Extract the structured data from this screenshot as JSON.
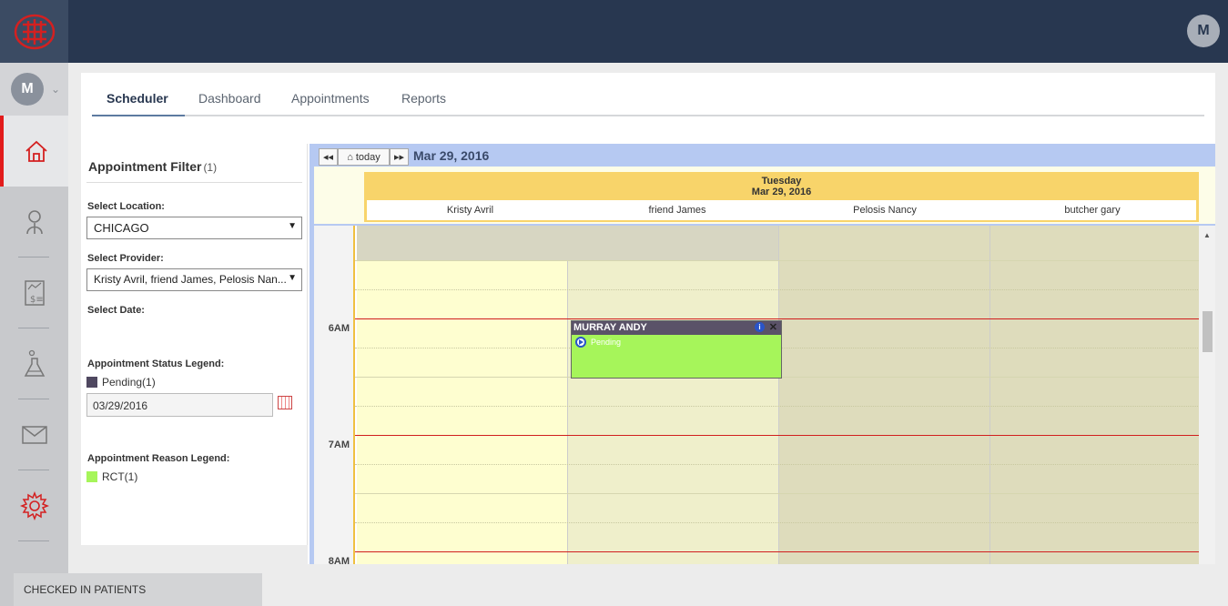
{
  "user": {
    "initial": "M"
  },
  "nav": {
    "items": [
      {
        "name": "home",
        "icon": "home-icon"
      },
      {
        "name": "patients",
        "icon": "person-icon"
      },
      {
        "name": "billing",
        "icon": "invoice-icon"
      },
      {
        "name": "lab",
        "icon": "flask-icon"
      },
      {
        "name": "messages",
        "icon": "mail-icon"
      },
      {
        "name": "settings",
        "icon": "gear-icon"
      }
    ],
    "accent": "#e21b1b"
  },
  "tabs": {
    "scheduler": "Scheduler",
    "dashboard": "Dashboard",
    "appointments": "Appointments",
    "reports": "Reports"
  },
  "filter": {
    "title": "Appointment Filter",
    "count": "(1)",
    "location_label": "Select Location:",
    "location_value": "CHICAGO",
    "provider_label": "Select Provider:",
    "provider_value": "Kristy Avril, friend James, Pelosis Nan...",
    "date_label": "Select Date:",
    "date_value": "03/29/2016",
    "status_legend_label": "Appointment Status Legend:",
    "status_legend": [
      {
        "label": "Pending(1)",
        "color": "#4f4860"
      }
    ],
    "reason_legend_label": "Appointment Reason Legend:",
    "reason_legend": [
      {
        "label": "RCT(1)",
        "color": "#a6f55a"
      }
    ]
  },
  "calendar": {
    "prev_label": "◂◂",
    "today_label": "today",
    "next_label": "▸▸",
    "current_date": "Mar 29, 2016",
    "day_name": "Tuesday",
    "day_date": "Mar 29, 2016",
    "providers": [
      "Kristy Avril",
      "friend James",
      "Pelosis Nancy",
      "butcher gary"
    ],
    "times": [
      "6AM",
      "7AM",
      "8AM"
    ],
    "event": {
      "patient": "MURRAY ANDY",
      "status": "Pending",
      "info_label": "i",
      "close_label": "✕"
    }
  },
  "footer": {
    "checked_in_label": "CHECKED IN PATIENTS"
  }
}
